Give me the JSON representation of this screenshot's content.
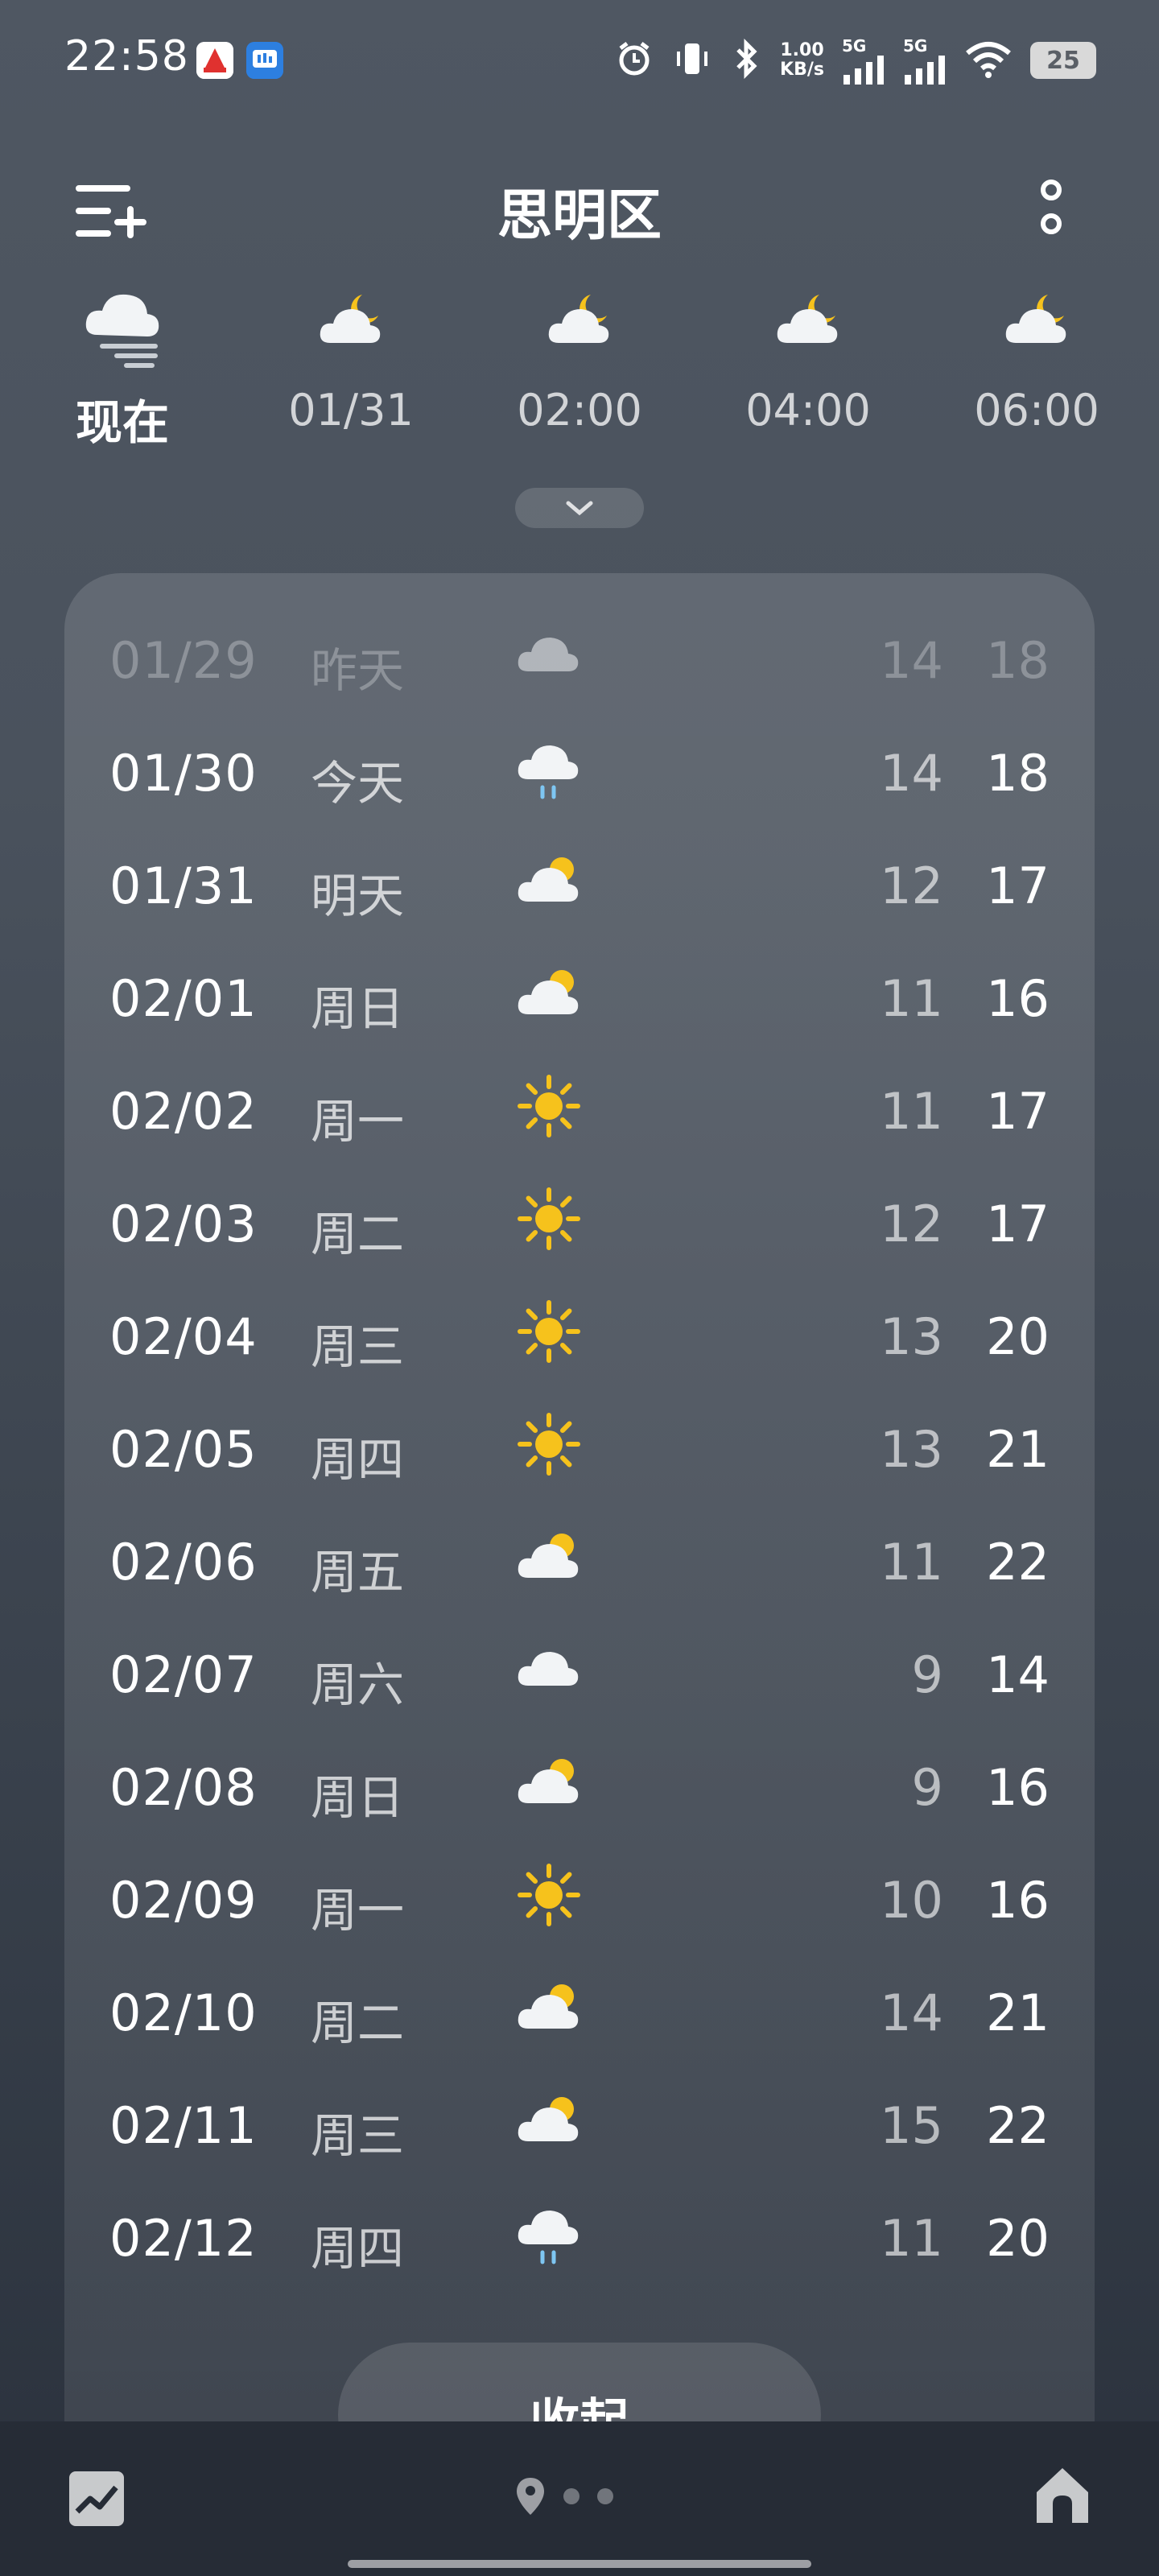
{
  "status_bar": {
    "time": "22:58",
    "net_speed_value": "1.00",
    "net_speed_unit": "KB/s",
    "signal1_label": "5G",
    "signal2_label": "5G",
    "battery": "25"
  },
  "header": {
    "city": "思明区"
  },
  "hourly": [
    {
      "label": "现在",
      "icon": "cloud-fog-icon"
    },
    {
      "label": "01/31",
      "icon": "moon-cloud-icon"
    },
    {
      "label": "02:00",
      "icon": "moon-cloud-icon"
    },
    {
      "label": "04:00",
      "icon": "moon-cloud-icon"
    },
    {
      "label": "06:00",
      "icon": "moon-cloud-icon"
    }
  ],
  "daily": [
    {
      "date": "01/29",
      "weekday": "昨天",
      "icon": "cloud-icon",
      "low": "14",
      "high": "18"
    },
    {
      "date": "01/30",
      "weekday": "今天",
      "icon": "rain-icon",
      "low": "14",
      "high": "18"
    },
    {
      "date": "01/31",
      "weekday": "明天",
      "icon": "partly-cloudy-icon",
      "low": "12",
      "high": "17"
    },
    {
      "date": "02/01",
      "weekday": "周日",
      "icon": "partly-cloudy-icon",
      "low": "11",
      "high": "16"
    },
    {
      "date": "02/02",
      "weekday": "周一",
      "icon": "sun-icon",
      "low": "11",
      "high": "17"
    },
    {
      "date": "02/03",
      "weekday": "周二",
      "icon": "sun-icon",
      "low": "12",
      "high": "17"
    },
    {
      "date": "02/04",
      "weekday": "周三",
      "icon": "sun-icon",
      "low": "13",
      "high": "20"
    },
    {
      "date": "02/05",
      "weekday": "周四",
      "icon": "sun-icon",
      "low": "13",
      "high": "21"
    },
    {
      "date": "02/06",
      "weekday": "周五",
      "icon": "partly-cloudy-icon",
      "low": "11",
      "high": "22"
    },
    {
      "date": "02/07",
      "weekday": "周六",
      "icon": "cloud-icon",
      "low": "9",
      "high": "14"
    },
    {
      "date": "02/08",
      "weekday": "周日",
      "icon": "partly-cloudy-icon",
      "low": "9",
      "high": "16"
    },
    {
      "date": "02/09",
      "weekday": "周一",
      "icon": "sun-icon",
      "low": "10",
      "high": "16"
    },
    {
      "date": "02/10",
      "weekday": "周二",
      "icon": "partly-cloudy-icon",
      "low": "14",
      "high": "21"
    },
    {
      "date": "02/11",
      "weekday": "周三",
      "icon": "partly-cloudy-icon",
      "low": "15",
      "high": "22"
    },
    {
      "date": "02/12",
      "weekday": "周四",
      "icon": "rain-icon",
      "low": "11",
      "high": "20"
    }
  ],
  "collapse_label": "收起",
  "colors": {
    "sun": "#f6c21c",
    "cloud": "#f2f4f6",
    "rain": "#7ec6f2"
  }
}
